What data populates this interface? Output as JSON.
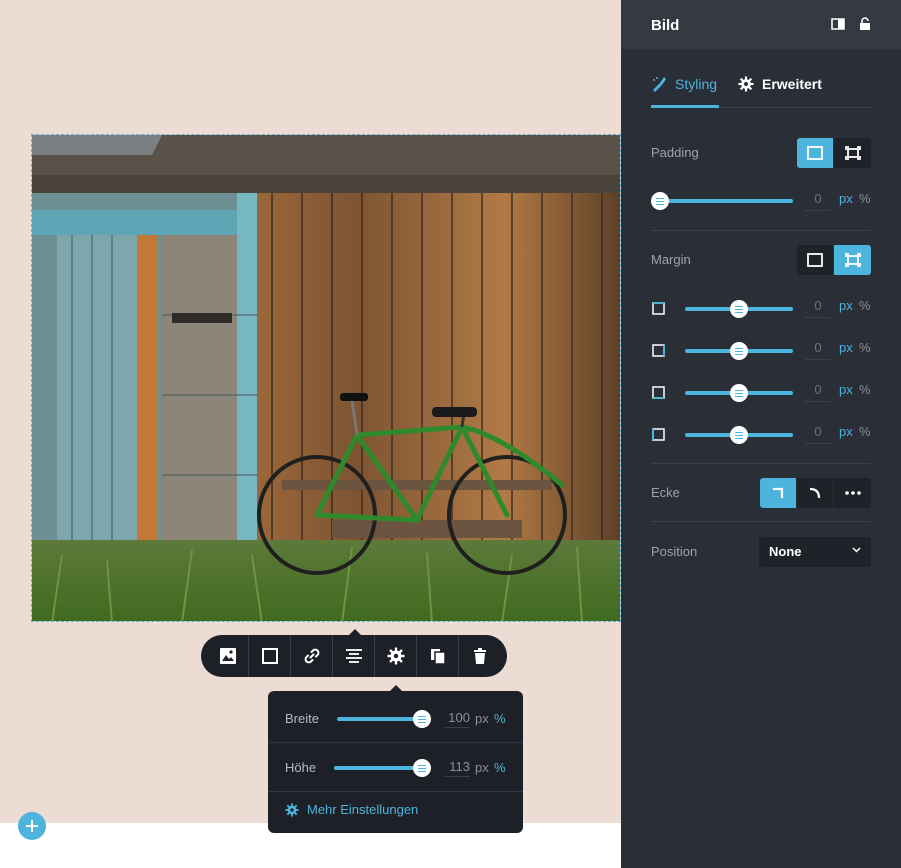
{
  "panel": {
    "title": "Bild",
    "tabs": [
      {
        "label": "Styling",
        "active": true
      },
      {
        "label": "Erweitert",
        "active": false
      }
    ],
    "padding": {
      "label": "Padding",
      "value": "0",
      "unit_px": "px",
      "unit_pct": "%",
      "slider_fraction": 0.0
    },
    "margin": {
      "label": "Margin",
      "rows": [
        {
          "side": "top",
          "value": "0",
          "unit_px": "px",
          "unit_pct": "%",
          "slider_fraction": 0.5
        },
        {
          "side": "right",
          "value": "0",
          "unit_px": "px",
          "unit_pct": "%",
          "slider_fraction": 0.5
        },
        {
          "side": "bottom",
          "value": "0",
          "unit_px": "px",
          "unit_pct": "%",
          "slider_fraction": 0.5
        },
        {
          "side": "left",
          "value": "0",
          "unit_px": "px",
          "unit_pct": "%",
          "slider_fraction": 0.5
        }
      ]
    },
    "corner": {
      "label": "Ecke"
    },
    "position": {
      "label": "Position",
      "selected": "None"
    }
  },
  "toolbar": {
    "icons": [
      "image-icon",
      "border-icon",
      "link-icon",
      "align-center-icon",
      "gear-icon",
      "copy-icon",
      "trash-icon"
    ]
  },
  "popup": {
    "width": {
      "label": "Breite",
      "value": "100",
      "unit_px": "px",
      "unit_pct": "%",
      "slider_fraction": 1.0
    },
    "height": {
      "label": "Höhe",
      "value": "113",
      "unit_px": "px",
      "unit_pct": "%",
      "slider_fraction": 1.0
    },
    "more_label": "Mehr Einstellungen"
  },
  "colors": {
    "accent": "#4cb4dd",
    "panel_bg": "#2a2e36",
    "canvas_bg": "#eddcd4",
    "toolbar_bg": "#1d2027"
  }
}
